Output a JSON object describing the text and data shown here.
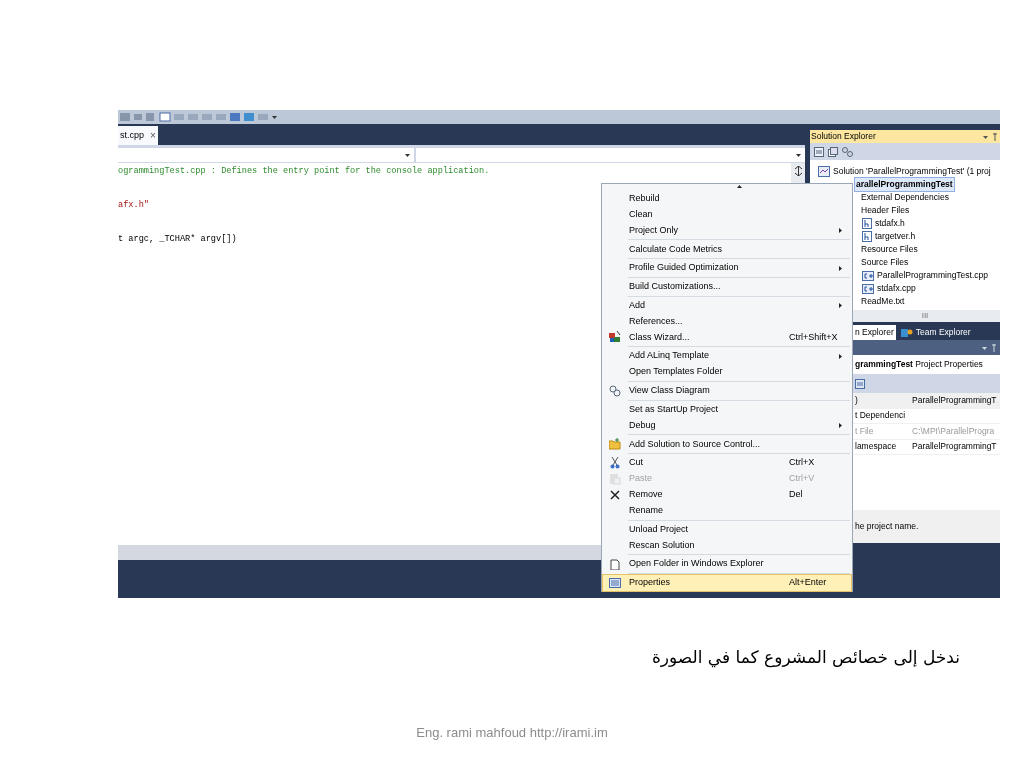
{
  "editor": {
    "tab": {
      "label": "st.cpp",
      "close": "×"
    },
    "code_lines": [
      {
        "kind": "comment",
        "text": "ogrammingTest.cpp : Defines the entry point for the console application."
      },
      {
        "kind": "string",
        "text": "afx.h\""
      },
      {
        "kind": "code",
        "text": "t argc, _TCHAR* argv[])"
      }
    ]
  },
  "context_menu": {
    "groups": [
      [
        {
          "label": "Rebuild",
          "submenu": false,
          "disabled": false,
          "highlighted": false
        },
        {
          "label": "Clean",
          "submenu": false,
          "disabled": false,
          "highlighted": false
        },
        {
          "label": "Project Only",
          "submenu": true,
          "disabled": false,
          "highlighted": false
        }
      ],
      [
        {
          "label": "Calculate Code Metrics",
          "submenu": false,
          "disabled": false,
          "highlighted": false
        }
      ],
      [
        {
          "label": "Profile Guided Optimization",
          "submenu": true,
          "disabled": false,
          "highlighted": false
        }
      ],
      [
        {
          "label": "Build Customizations...",
          "submenu": false,
          "disabled": false,
          "highlighted": false
        }
      ],
      [
        {
          "label": "Add",
          "submenu": true,
          "disabled": false,
          "highlighted": false
        },
        {
          "label": "References...",
          "submenu": false,
          "disabled": false,
          "highlighted": false
        },
        {
          "label": "Class Wizard...",
          "shortcut": "Ctrl+Shift+X",
          "submenu": false,
          "disabled": false,
          "highlighted": false
        }
      ],
      [
        {
          "label": "Add ALinq Template",
          "submenu": true,
          "disabled": false,
          "highlighted": false
        },
        {
          "label": "Open Templates Folder",
          "submenu": false,
          "disabled": false,
          "highlighted": false
        }
      ],
      [
        {
          "label": "View Class Diagram",
          "submenu": false,
          "disabled": false,
          "highlighted": false
        }
      ],
      [
        {
          "label": "Set as StartUp Project",
          "submenu": false,
          "disabled": false,
          "highlighted": false
        },
        {
          "label": "Debug",
          "submenu": true,
          "disabled": false,
          "highlighted": false
        }
      ],
      [
        {
          "label": "Add Solution to Source Control...",
          "submenu": false,
          "disabled": false,
          "highlighted": false
        }
      ],
      [
        {
          "label": "Cut",
          "shortcut": "Ctrl+X",
          "submenu": false,
          "disabled": false,
          "highlighted": false
        },
        {
          "label": "Paste",
          "shortcut": "Ctrl+V",
          "submenu": false,
          "disabled": true,
          "highlighted": false
        },
        {
          "label": "Remove",
          "shortcut": "Del",
          "submenu": false,
          "disabled": false,
          "highlighted": false
        },
        {
          "label": "Rename",
          "submenu": false,
          "disabled": false,
          "highlighted": false
        }
      ],
      [
        {
          "label": "Unload Project",
          "submenu": false,
          "disabled": false,
          "highlighted": false
        },
        {
          "label": "Rescan Solution",
          "submenu": false,
          "disabled": false,
          "highlighted": false
        }
      ],
      [
        {
          "label": "Open Folder in Windows Explorer",
          "submenu": false,
          "disabled": false,
          "highlighted": false
        }
      ],
      [
        {
          "label": "Properties",
          "shortcut": "Alt+Enter",
          "submenu": false,
          "disabled": false,
          "highlighted": true
        }
      ]
    ]
  },
  "solution_explorer": {
    "title": "Solution Explorer",
    "tree": [
      {
        "kind": "solution",
        "label": "Solution 'ParallelProgrammingTest' (1 proj",
        "selected": false,
        "children": [
          {
            "label": "arallelProgrammingTest",
            "selected": true,
            "children": [
              {
                "label": "External Dependencies",
                "selected": false
              },
              {
                "label": "Header Files",
                "selected": false,
                "children": [
                  {
                    "kind": "header",
                    "label": "stdafx.h",
                    "selected": false
                  },
                  {
                    "kind": "header",
                    "label": "targetver.h",
                    "selected": false
                  }
                ]
              },
              {
                "label": "Resource Files",
                "selected": false
              },
              {
                "label": "Source Files",
                "selected": false,
                "children": [
                  {
                    "kind": "source",
                    "label": "ParallelProgrammingTest.cpp",
                    "selected": false
                  },
                  {
                    "kind": "source",
                    "label": "stdafx.cpp",
                    "selected": false
                  }
                ]
              },
              {
                "label": "ReadMe.txt",
                "selected": false
              }
            ]
          }
        ]
      }
    ],
    "scrollbar_grip": "III"
  },
  "panel_tabs": [
    {
      "label": "n Explorer",
      "selected": true
    },
    {
      "label": "Team Explorer",
      "selected": false
    }
  ],
  "properties": {
    "heading": "**grammingTest** Project Properties",
    "rows": [
      {
        "name": ")",
        "value": "ParallelProgrammingT",
        "disabled": false
      },
      {
        "name": "t Dependenci",
        "disabled": false
      },
      {
        "name": "t File",
        "value": "C:\\MPI\\ParallelProgra",
        "disabled": true
      },
      {
        "name": "lamespace",
        "value": "ParallelProgrammingT",
        "disabled": false
      }
    ],
    "description": "he project name."
  },
  "caption": "ندخل إلى خصائص المشروع  كما في الصورة",
  "footer": "Eng. rami mahfoud http://irami.im"
}
